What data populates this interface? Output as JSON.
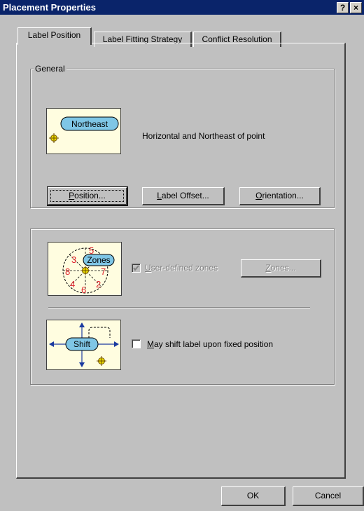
{
  "window": {
    "title": "Placement Properties",
    "help_label": "?",
    "close_label": "×"
  },
  "tabs": [
    {
      "label": "Label Position",
      "active": true
    },
    {
      "label": "Label Fitting Strategy",
      "active": false
    },
    {
      "label": "Conflict Resolution",
      "active": false
    }
  ],
  "general": {
    "legend": "General",
    "preview_label": "Northeast",
    "description": "Horizontal and Northeast of point",
    "position_button": {
      "mnemonic": "P",
      "rest": "osition..."
    },
    "offset_button": {
      "mnemonic": "L",
      "rest": "abel Offset..."
    },
    "orientation_button": {
      "mnemonic": "O",
      "rest": "rientation..."
    }
  },
  "zones": {
    "preview_label": "Zones",
    "zone_numbers": [
      "5",
      "3",
      "8",
      "7",
      "4",
      "6",
      "2"
    ],
    "user_defined": {
      "mnemonic": "U",
      "rest": "ser-defined zones",
      "checked": true,
      "enabled": false
    },
    "zones_button": {
      "mnemonic": "Z",
      "rest": "ones...",
      "enabled": false
    }
  },
  "shift": {
    "preview_label": "Shift",
    "checkbox": {
      "mnemonic": "M",
      "rest": "ay shift label upon fixed position",
      "checked": false
    }
  },
  "footer": {
    "ok_label": "OK",
    "cancel_label": "Cancel"
  },
  "colors": {
    "titlebar": "#0a246a",
    "face": "#c0c0c0",
    "preview_bg": "#fffde0",
    "label_bubble": "#7fc6e6",
    "zone_number": "#e0202a",
    "symbol": "#b8a000"
  }
}
